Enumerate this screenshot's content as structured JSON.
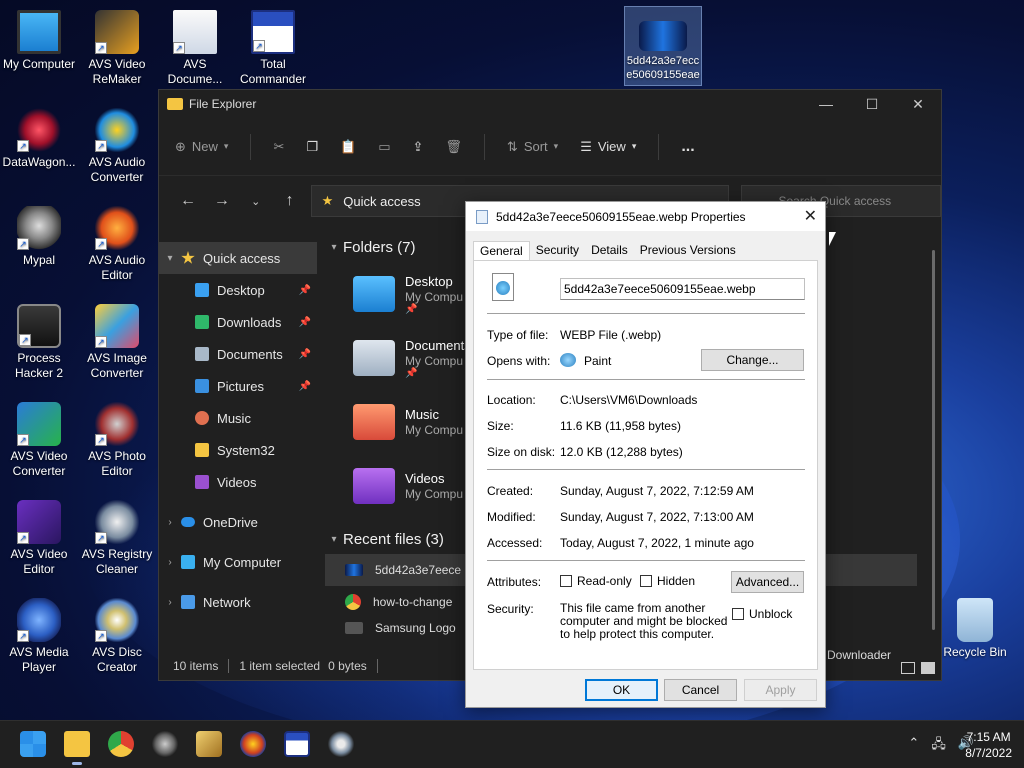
{
  "desktop": {
    "icons": [
      {
        "label": "My Computer"
      },
      {
        "label": "AVS Video ReMaker"
      },
      {
        "label": "AVS Docume..."
      },
      {
        "label": "Total Commander"
      },
      {
        "label": "DataWagon..."
      },
      {
        "label": "AVS Audio Converter"
      },
      {
        "label": "Mypal"
      },
      {
        "label": "AVS Audio Editor"
      },
      {
        "label": "Process Hacker 2"
      },
      {
        "label": "AVS Image Converter"
      },
      {
        "label": "AVS Video Converter"
      },
      {
        "label": "AVS Photo Editor"
      },
      {
        "label": "AVS Video Editor"
      },
      {
        "label": "AVS Registry Cleaner"
      },
      {
        "label": "AVS Media Player"
      },
      {
        "label": "AVS Disc Creator"
      },
      {
        "label": "5dd42a3e7ecce50609155eae"
      },
      {
        "label": "Recycle Bin"
      }
    ]
  },
  "explorer": {
    "title": "File Explorer",
    "toolbar": {
      "new": "New",
      "sort": "Sort",
      "view": "View",
      "more": "..."
    },
    "address": "Quick access",
    "search_placeholder": "Search Quick access",
    "sidebar": [
      {
        "label": "Quick access"
      },
      {
        "label": "Desktop"
      },
      {
        "label": "Downloads"
      },
      {
        "label": "Documents"
      },
      {
        "label": "Pictures"
      },
      {
        "label": "Music"
      },
      {
        "label": "System32"
      },
      {
        "label": "Videos"
      },
      {
        "label": "OneDrive"
      },
      {
        "label": "My Computer"
      },
      {
        "label": "Network"
      }
    ],
    "folders_header": "Folders (7)",
    "folders": [
      {
        "name": "Desktop",
        "sub": "My Compu"
      },
      {
        "name": "Documents",
        "sub": "My Compu"
      },
      {
        "name": "Music",
        "sub": "My Compu"
      },
      {
        "name": "Videos",
        "sub": "My Compu"
      }
    ],
    "recent_header": "Recent files (3)",
    "recent": [
      {
        "name": "5dd42a3e7eece"
      },
      {
        "name": "how-to-change"
      },
      {
        "name": "Samsung Logo"
      }
    ],
    "recent_trailing": "Downloader",
    "status": {
      "items": "10 items",
      "selected": "1 item selected",
      "size": "0 bytes"
    }
  },
  "dialog": {
    "title": "5dd42a3e7eece50609155eae.webp Properties",
    "tabs": [
      "General",
      "Security",
      "Details",
      "Previous Versions"
    ],
    "filename": "5dd42a3e7eece50609155eae.webp",
    "type_label": "Type of file:",
    "type_value": "WEBP File (.webp)",
    "opens_label": "Opens with:",
    "opens_value": "Paint",
    "change_btn": "Change...",
    "location_label": "Location:",
    "location_value": "C:\\Users\\VM6\\Downloads",
    "size_label": "Size:",
    "size_value": "11.6 KB (11,958 bytes)",
    "sizedisk_label": "Size on disk:",
    "sizedisk_value": "12.0 KB (12,288 bytes)",
    "created_label": "Created:",
    "created_value": "Sunday, August 7, 2022, 7:12:59 AM",
    "modified_label": "Modified:",
    "modified_value": "Sunday, August 7, 2022, 7:13:00 AM",
    "accessed_label": "Accessed:",
    "accessed_value": "Today, August 7, 2022, 1 minute ago",
    "attributes_label": "Attributes:",
    "readonly": "Read-only",
    "hidden": "Hidden",
    "advanced_btn": "Advanced...",
    "security_label": "Security:",
    "security_text": "This file came from another computer and might be blocked to help protect this computer.",
    "unblock": "Unblock",
    "ok": "OK",
    "cancel": "Cancel",
    "apply": "Apply"
  },
  "taskbar": {
    "time": "7:15 AM",
    "date": "8/7/2022"
  }
}
